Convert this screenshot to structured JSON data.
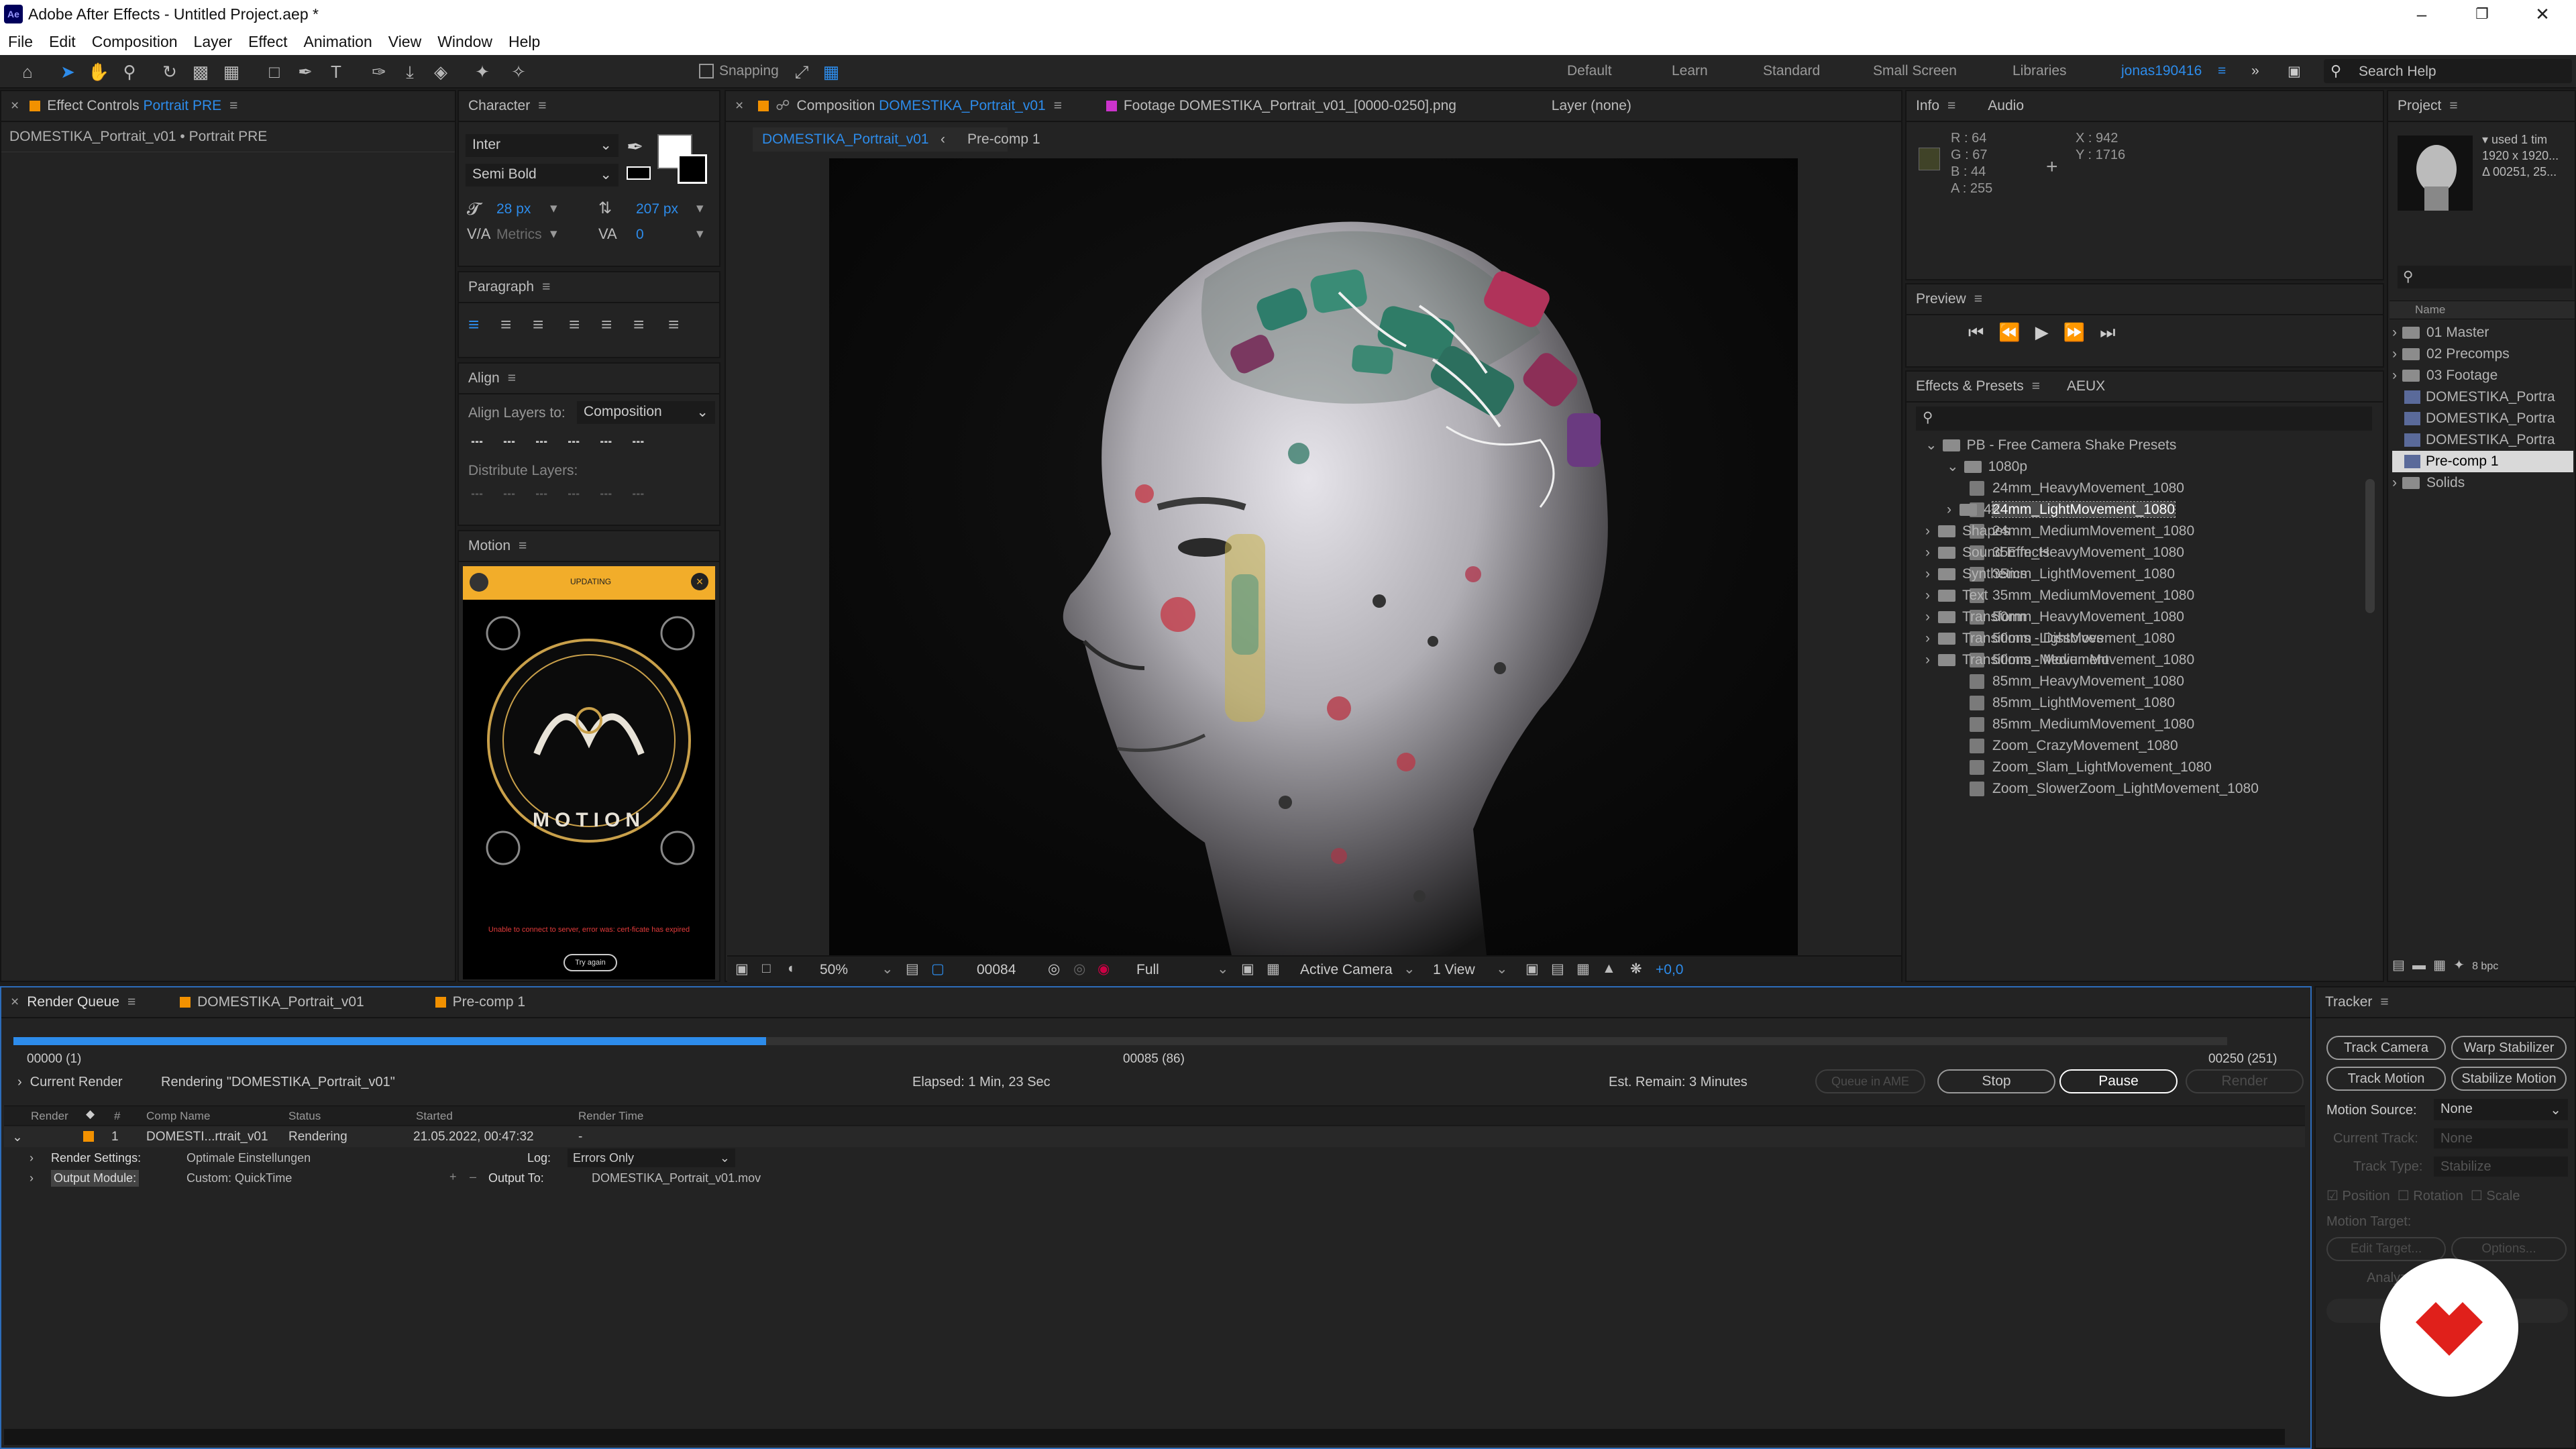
{
  "window": {
    "title": "Adobe After Effects - Untitled Project.aep *",
    "icon": "Ae"
  },
  "menu": [
    "File",
    "Edit",
    "Composition",
    "Layer",
    "Effect",
    "Animation",
    "View",
    "Window",
    "Help"
  ],
  "toolbar": {
    "snapping": "Snapping",
    "workspaces": [
      "Default",
      "Learn",
      "Standard",
      "Small Screen",
      "Libraries"
    ],
    "user": "jonas190416",
    "search": "Search Help"
  },
  "effect_controls": {
    "tab_label": "Effect Controls",
    "tab_value": "Portrait PRE",
    "subtitle": "DOMESTIKA_Portrait_v01 • Portrait PRE"
  },
  "character": {
    "title": "Character",
    "font": "Inter",
    "style": "Semi Bold",
    "size": "28 px",
    "leading": "207 px",
    "kerning": "Metrics",
    "tracking": "0"
  },
  "paragraph": {
    "title": "Paragraph"
  },
  "align": {
    "title": "Align",
    "align_to_label": "Align Layers to:",
    "align_to": "Composition",
    "distribute": "Distribute Layers:"
  },
  "motion": {
    "title": "Motion",
    "status": "UPDATING",
    "logo_text": "MOTION",
    "error": "Unable to connect to server, error was: cert-ficate has expired",
    "retry": "Try again"
  },
  "composition": {
    "tab_prefix": "Composition",
    "tab_name": "DOMESTIKA_Portrait_v01",
    "footage_tab": "Footage  DOMESTIKA_Portrait_v01_[0000-0250].png",
    "layer_tab": "Layer  (none)",
    "crumb_active": "DOMESTIKA_Portrait_v01",
    "crumb_other": "Pre-comp 1",
    "zoom": "50%",
    "timecode": "00084",
    "resolution": "Full",
    "camera": "Active Camera",
    "views": "1 View",
    "exposure": "+0,0"
  },
  "info": {
    "title": "Info",
    "audio_tab": "Audio",
    "r": "R : 64",
    "g": "G : 67",
    "b": "B : 44",
    "a": "A : 255",
    "x": "X : 942",
    "y": "Y : 1716"
  },
  "preview": {
    "title": "Preview"
  },
  "effects": {
    "title": "Effects & Presets",
    "aeux": "AEUX",
    "root": "PB - Free Camera Shake Presets",
    "group": "1080p",
    "presets": [
      "24mm_HeavyMovement_1080",
      "24mm_LightMovement_1080",
      "24mm_MediumMovement_1080",
      "35mm_HeavyMovement_1080",
      "35mm_LightMovement_1080",
      "35mm_MediumMovement_1080",
      "50mm_HeavyMovement_1080",
      "50mm_LightMovement_1080",
      "50mm_MediumMovement_1080",
      "85mm_HeavyMovement_1080",
      "85mm_LightMovement_1080",
      "85mm_MediumMovement_1080",
      "Zoom_CrazyMovement_1080",
      "Zoom_Slam_LightMovement_1080",
      "Zoom_SlowerZoom_LightMovement_1080"
    ],
    "selected_index": 1,
    "after": [
      "4K",
      "Shapes",
      "Sound Effects",
      "Synthetics",
      "Text",
      "Transform",
      "Transitions - Dissolves",
      "Transitions - Movement"
    ]
  },
  "project": {
    "title": "Project",
    "used": "used 1 tim",
    "dims": "1920 x 1920...",
    "dur": "Δ 00251, 25...",
    "col_name": "Name",
    "items": [
      "01 Master",
      "02 Precomps",
      "03 Footage",
      "DOMESTIKA_Portra",
      "DOMESTIKA_Portra",
      "DOMESTIKA_Portra",
      "Pre-comp 1",
      "Solids"
    ],
    "bpc": "8 bpc"
  },
  "render_queue": {
    "tab": "Render Queue",
    "tab2": "DOMESTIKA_Portrait_v01",
    "tab3": "Pre-comp 1",
    "progress": 0.34,
    "start": "00000 (1)",
    "current": "00085 (86)",
    "end": "00250 (251)",
    "current_render_label": "Current Render",
    "rendering_text": "Rendering \"DOMESTIKA_Portrait_v01\"",
    "elapsed": "Elapsed: 1 Min, 23 Sec",
    "remain": "Est. Remain: 3 Minutes",
    "queue_ame": "Queue in AME",
    "stop": "Stop",
    "pause": "Pause",
    "render": "Render",
    "cols": [
      "Render",
      "#",
      "Comp Name",
      "Status",
      "Started",
      "Render Time"
    ],
    "item": {
      "num": "1",
      "name": "DOMESTI...rtrait_v01",
      "status": "Rendering",
      "started": "21.05.2022, 00:47:32",
      "time": "-"
    },
    "settings_label": "Render Settings:",
    "settings_val": "Optimale Einstellungen",
    "log_label": "Log:",
    "log_val": "Errors Only",
    "output_label": "Output Module:",
    "output_val": "Custom: QuickTime",
    "output_to_label": "Output To:",
    "output_to_val": "DOMESTIKA_Portrait_v01.mov"
  },
  "tracker": {
    "title": "Tracker",
    "track_camera": "Track Camera",
    "warp": "Warp Stabilizer",
    "track_motion": "Track Motion",
    "stabilize": "Stabilize Motion",
    "source_label": "Motion Source:",
    "source_val": "None",
    "current_track": "Current Track:",
    "current_track_val": "None",
    "track_type": "Track Type:",
    "track_type_val": "Stabilize",
    "position": "Position",
    "rotation": "Rotation",
    "scale": "Scale",
    "motion_target": "Motion Target:",
    "edit_target": "Edit Target...",
    "options": "Options...",
    "analyze": "Analyze:"
  }
}
